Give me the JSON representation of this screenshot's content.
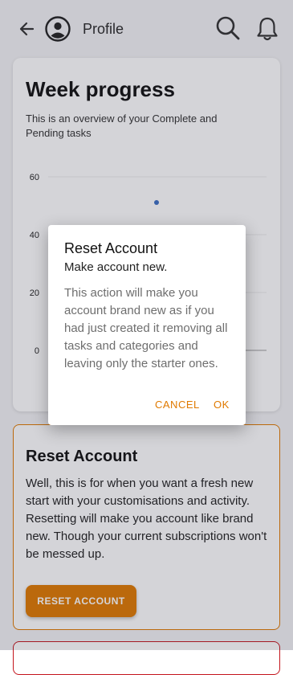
{
  "header": {
    "title": "Profile"
  },
  "week_card": {
    "title": "Week progress",
    "description": "This is an overview of your Complete and Pending tasks"
  },
  "chart_data": {
    "type": "scatter",
    "y_ticks": [
      "60",
      "40",
      "20",
      "0"
    ],
    "ylim": [
      0,
      60
    ],
    "series": [
      {
        "values": [
          50
        ]
      }
    ],
    "grid": true
  },
  "reset_card": {
    "title": "Reset Account",
    "body": "Well, this is for when you want a fresh new start with your customisations and activity. Resetting will make you account like brand new. Though your current subscriptions won't be messed up.",
    "button_label": "RESET ACCOUNT"
  },
  "dialog": {
    "title": "Reset Account",
    "subtitle": "Make account new.",
    "body": "This action will make you account brand new as if you had just created it removing all tasks and categories and leaving only the starter ones.",
    "cancel_label": "CANCEL",
    "ok_label": "OK"
  },
  "colors": {
    "accent": "#e07a00",
    "danger": "#c4141c",
    "chart_point": "#3b6fc4"
  }
}
